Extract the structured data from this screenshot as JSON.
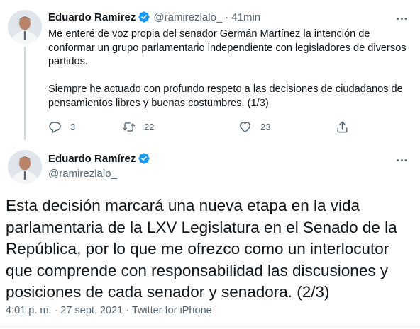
{
  "colors": {
    "verified": "#1d9bf0",
    "secondary_text": "#536471",
    "primary_text": "#0f1419",
    "thread_line": "#cfd9de"
  },
  "tweet1": {
    "author_name": "Eduardo Ramírez",
    "handle": "@ramirezlalo_",
    "separator": "·",
    "time": "41min",
    "paragraphs": [
      "Me enteré de voz propia del senador Germán Martínez la intención de conformar un grupo parlamentario independiente con legisladores de diversos partidos.",
      "Siempre he actuado con profundo respeto a las decisiones de ciudadanos de pensamientos libres y buenas costumbres. (1/3)"
    ],
    "replies": "3",
    "retweets": "22",
    "likes": "23",
    "icons": {
      "reply": "reply-icon",
      "retweet": "retweet-icon",
      "like": "heart-icon",
      "share": "share-icon",
      "more": "more-icon",
      "verified": "verified-badge-icon"
    }
  },
  "tweet2": {
    "author_name": "Eduardo Ramírez",
    "handle": "@ramirezlalo_",
    "text": "Esta decisión marcará una nueva etapa en la vida parlamentaria de la LXV Legislatura en el Senado de la República, por lo que me ofrezco como un interlocutor que comprende con responsabilidad las discusiones y posiciones de cada senador y senadora. (2/3)",
    "meta": "4:01 p. m. · 27 sept. 2021 · Twitter for iPhone"
  }
}
